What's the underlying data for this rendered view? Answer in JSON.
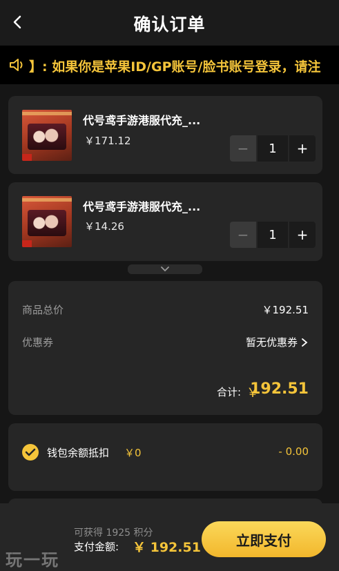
{
  "header": {
    "title": "确认订单",
    "back_icon": "chevron-left-icon"
  },
  "notice": {
    "icon": "speaker-icon",
    "text": "】: 如果你是苹果ID/GP账号/脸书账号登录，请注"
  },
  "products": [
    {
      "name": "代号鸢手游港服代充_...",
      "price": "￥171.12",
      "quantity": "1",
      "minus": "−",
      "plus": "+"
    },
    {
      "name": "代号鸢手游港服代充_...",
      "price": "￥14.26",
      "quantity": "1",
      "minus": "−",
      "plus": "+"
    }
  ],
  "summary": {
    "total_label": "商品总价",
    "total_value": "￥192.51",
    "coupon_label": "优惠券",
    "coupon_value": "暂无优惠券",
    "sum_label": "合计:",
    "sum_currency": "￥",
    "sum_value": "192.51"
  },
  "wallet": {
    "label": "钱包余额抵扣",
    "amount": "￥0",
    "deduct": "- 0.00"
  },
  "footer": {
    "points": "可获得 1925 积分",
    "pay_label": "支付金额:",
    "pay_value": "￥ 192.51",
    "pay_button": "立即支付"
  },
  "watermark": "玩一玩",
  "colors": {
    "accent": "#f4c43a",
    "background": "#161616",
    "card": "#262626"
  }
}
